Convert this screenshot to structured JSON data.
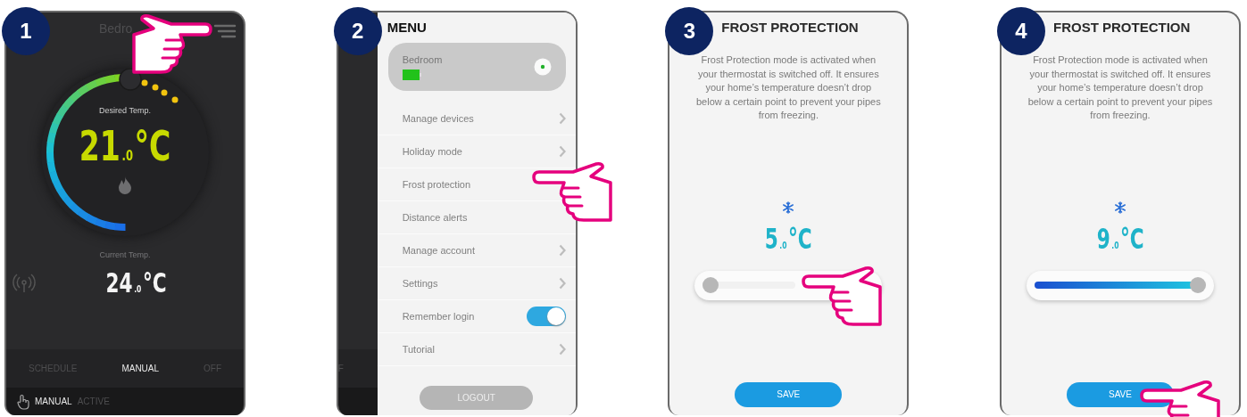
{
  "screens": [
    {
      "kind": "thermostat",
      "step": "1",
      "title": "Bedro",
      "desired_label": "Desired Temp.",
      "desired_temp": "21$_{.0}$°C",
      "current_label": "Current Temp.",
      "current_temp": "24$_{.0}$°C",
      "modes": [
        {
          "label": "SCHEDULE",
          "selected": false
        },
        {
          "label": "MANUAL",
          "selected": true
        },
        {
          "label": "OFF",
          "selected": false
        }
      ],
      "status": {
        "mode": "MANUAL",
        "state": "ACTIVE"
      }
    },
    {
      "kind": "menu",
      "step": "2",
      "behind_text": "F",
      "title": "MENU",
      "device": {
        "name": "Bedroom"
      },
      "items": [
        {
          "kind": "link",
          "label": "Manage devices"
        },
        {
          "kind": "link",
          "label": "Holiday mode"
        },
        {
          "kind": "plain",
          "label": "Frost protection"
        },
        {
          "kind": "plain",
          "label": "Distance alerts"
        },
        {
          "kind": "link",
          "label": "Manage account"
        },
        {
          "kind": "link",
          "label": "Settings"
        },
        {
          "kind": "toggle",
          "label": "Remember login",
          "on": true
        },
        {
          "kind": "link",
          "label": "Tutorial"
        }
      ],
      "logout": "LOGOUT"
    },
    {
      "kind": "frost",
      "step": "3",
      "title": "FROST PROTECTION",
      "description": "Frost Protection mode is activated when your thermostat is switched off. It ensures your home’s temperature doesn’t drop below a certain point to prevent your pipes from freezing.",
      "temperature": "5$_{.0}$°C",
      "slider": {
        "level": 0
      },
      "save": "SAVE"
    },
    {
      "kind": "frost",
      "step": "4",
      "title": "FROST PROTECTION",
      "description": "Frost Protection mode is activated when your thermostat is switched off. It ensures your home’s temperature doesn’t drop below a certain point to prevent your pipes from freezing.",
      "temperature": "9$_{.0}$°C",
      "slider": {
        "level": 1
      },
      "save": "SAVE"
    }
  ]
}
